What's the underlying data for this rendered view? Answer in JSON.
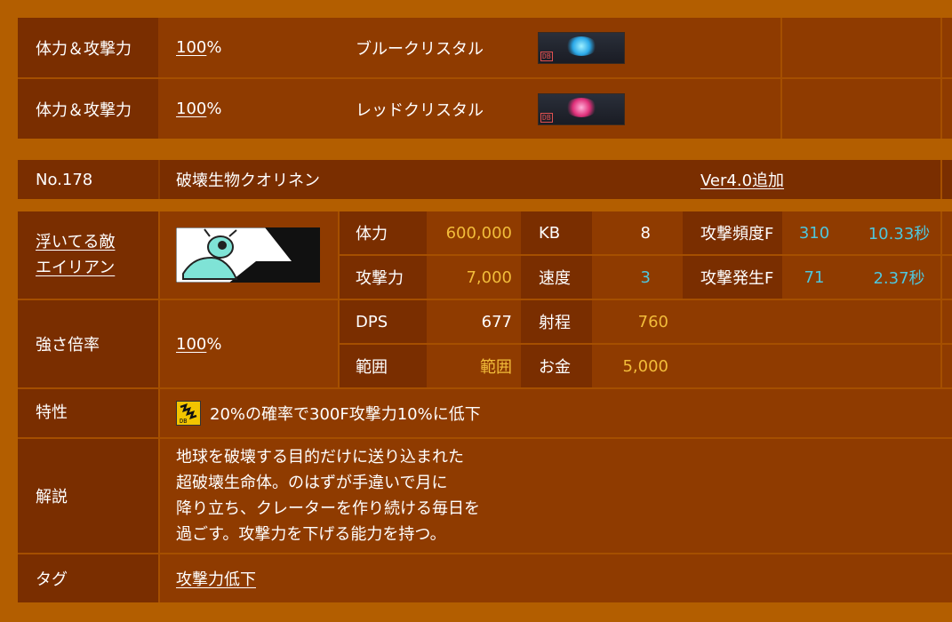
{
  "crystals": [
    {
      "label": "体力＆攻撃力",
      "percent": "100",
      "unit": " %",
      "name": "ブルークリスタル",
      "icon": "blue-crystal-icon",
      "color": "#46c8ff"
    },
    {
      "label": "体力＆攻撃力",
      "percent": "100",
      "unit": " %",
      "name": "レッドクリスタル",
      "icon": "red-crystal-icon",
      "color": "#ff3d8a"
    }
  ],
  "enemy": {
    "number": "No.178",
    "name": "破壊生物クオリネン",
    "version": "Ver4.0追加",
    "traits_line1": "浮いてる敵",
    "traits_line2": "エイリアン",
    "stats": {
      "hp_label": "体力",
      "hp": "600,000",
      "kb_label": "KB",
      "kb": "8",
      "freq_label": "攻撃頻度F",
      "freq_f": "310",
      "freq_s": "10.33秒",
      "atk_label": "攻撃力",
      "atk": "7,000",
      "speed_label": "速度",
      "speed": "3",
      "occur_label": "攻撃発生F",
      "occur_f": "71",
      "occur_s": "2.37秒",
      "dps_label": "DPS",
      "dps": "677",
      "range_label": "射程",
      "range": "760",
      "area_label": "範囲",
      "area": "範囲",
      "money_label": "お金",
      "money": "5,000"
    },
    "strength_label": "強さ倍率",
    "strength": "100",
    "strength_unit": " %",
    "ability_label": "特性",
    "ability": "20%の確率で300F攻撃力10%に低下",
    "desc_label": "解説",
    "desc_lines": [
      "地球を破壊する目的だけに送り込まれた",
      "超破壊生命体。のはずが手違いで月に",
      "降り立ち、クレーターを作り続ける毎日を",
      "過ごす。攻撃力を下げる能力を持つ。"
    ],
    "tag_label": "タグ",
    "tag": "攻撃力低下"
  },
  "colors": {
    "yellow": "#f2bc3a",
    "cyan": "#4fc6dc",
    "bg": "#b35e00"
  }
}
